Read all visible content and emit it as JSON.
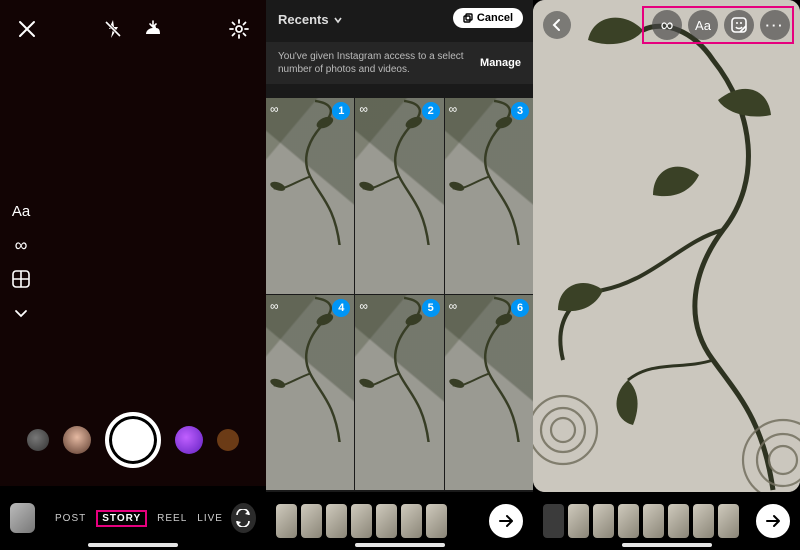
{
  "panel1": {
    "close_label": "close",
    "flash_label": "flash-off",
    "save_label": "save",
    "settings_label": "settings",
    "tools": {
      "text": "Aa",
      "boomerang": "∞",
      "layout": "layout",
      "more": "more"
    },
    "modes": {
      "post": "POST",
      "story": "STORY",
      "reel": "REEL",
      "live": "LIVE"
    }
  },
  "panel2": {
    "album_label": "Recents",
    "cancel_label": "Cancel",
    "access_msg": "You've given Instagram access to a select number of photos and videos.",
    "manage_label": "Manage",
    "items": [
      {
        "boomerang": "∞",
        "n": "1"
      },
      {
        "boomerang": "∞",
        "n": "2"
      },
      {
        "boomerang": "∞",
        "n": "3"
      },
      {
        "boomerang": "∞",
        "n": "4"
      },
      {
        "boomerang": "∞",
        "n": "5"
      },
      {
        "boomerang": "∞",
        "n": "6"
      }
    ],
    "strip_count": 7
  },
  "panel3": {
    "tools": {
      "boomerang": "∞",
      "text": "Aa",
      "sticker": "sticker",
      "more": "…"
    },
    "strip_count": 7
  }
}
